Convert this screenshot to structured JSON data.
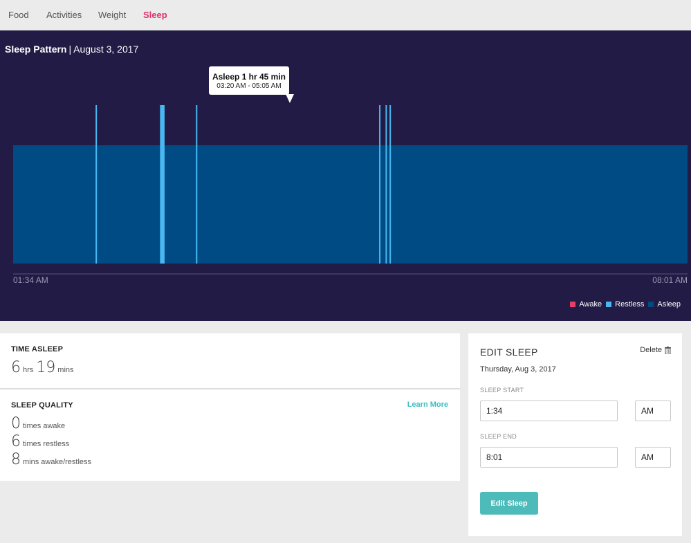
{
  "nav": {
    "tabs": [
      {
        "label": "Food"
      },
      {
        "label": "Activities"
      },
      {
        "label": "Weight"
      },
      {
        "label": "Sleep"
      }
    ],
    "active_tab": "Sleep"
  },
  "panel": {
    "title": "Sleep Pattern",
    "separator": "|",
    "date": "August 3, 2017"
  },
  "tooltip": {
    "title": "Asleep 1 hr 45 min",
    "range": "03:20 AM - 05:05 AM"
  },
  "chart_data": {
    "type": "area",
    "x_start": "01:34 AM",
    "x_end": "08:01 AM",
    "total_minutes": 387,
    "levels": [
      "Asleep",
      "Restless",
      "Awake"
    ],
    "asleep_span_minutes": [
      0,
      387
    ],
    "restless_marks_minutes": [
      {
        "start": 47.3,
        "duration": 0.8
      },
      {
        "start": 84.3,
        "duration": 2.6
      },
      {
        "start": 104.9,
        "duration": 0.8
      },
      {
        "start": 210.0,
        "duration": 0.8
      },
      {
        "start": 213.7,
        "duration": 0.8
      },
      {
        "start": 216.0,
        "duration": 0.8
      }
    ],
    "legend": [
      {
        "name": "Awake",
        "color": "#e53e6b"
      },
      {
        "name": "Restless",
        "color": "#4ab8f0"
      },
      {
        "name": "Asleep",
        "color": "#004b84"
      }
    ],
    "legend_position": "bottom-right"
  },
  "stats": {
    "time_asleep_heading": "TIME ASLEEP",
    "hours": "6",
    "hours_unit": "hrs",
    "minutes": "19",
    "minutes_unit": "mins",
    "quality_heading": "SLEEP QUALITY",
    "learn_more": "Learn More",
    "quality_rows": [
      {
        "value": "0",
        "label": "times awake"
      },
      {
        "value": "6",
        "label": "times restless"
      },
      {
        "value": "8",
        "label": "mins awake/restless"
      }
    ]
  },
  "edit": {
    "title": "EDIT SLEEP",
    "delete_label": "Delete",
    "date": "Thursday, Aug 3, 2017",
    "start_label": "SLEEP START",
    "start_time": "1:34",
    "start_ampm": "AM",
    "end_label": "SLEEP END",
    "end_time": "8:01",
    "end_ampm": "AM",
    "button_label": "Edit Sleep"
  },
  "colors": {
    "panel_bg": "#211b45",
    "accent_pink": "#e1306c",
    "teal": "#4dbbb9",
    "asleep": "#004b84",
    "restless": "#4ab8f0",
    "awake": "#e53e6b"
  }
}
